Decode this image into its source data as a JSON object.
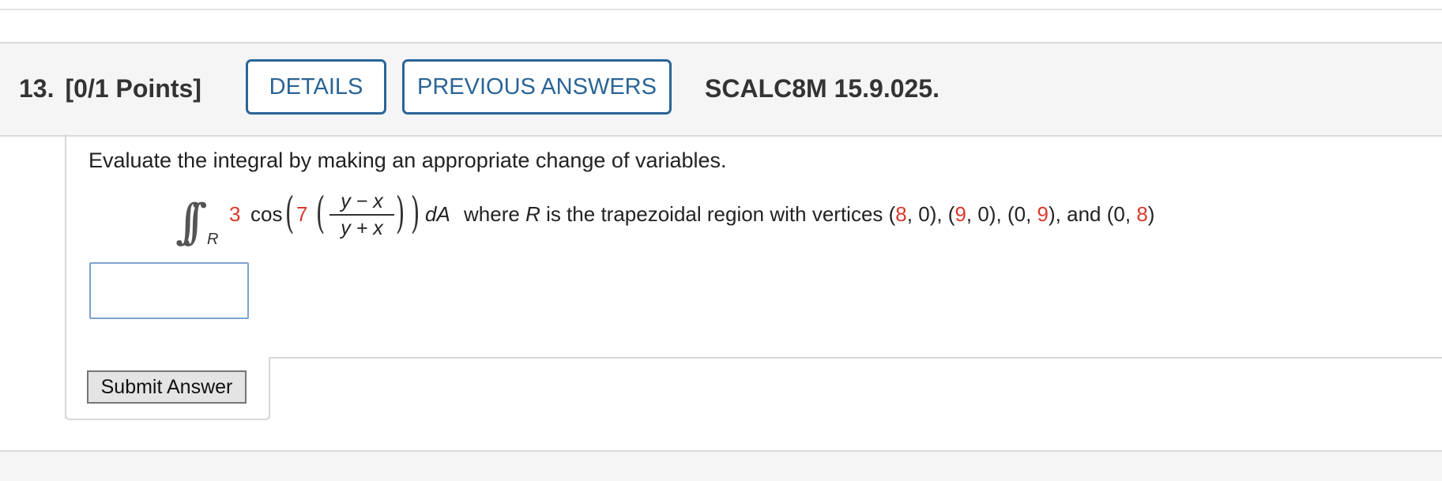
{
  "question": {
    "number": "13.",
    "points": "[0/1 Points]",
    "details_label": "DETAILS",
    "previous_answers_label": "PREVIOUS ANSWERS",
    "reference_code": "SCALC8M 15.9.025."
  },
  "problem": {
    "prompt": "Evaluate the integral by making an appropriate change of variables.",
    "integral_symbol": "∫∫",
    "region_subscript": "R",
    "coefficient": "3",
    "function": "cos",
    "inner_coefficient": "7",
    "numerator": "y − x",
    "denominator": "y + x",
    "differential": "dA",
    "where_text": "where",
    "region_var": "R",
    "description": "is the trapezoidal region with vertices",
    "vertices": [
      {
        "x": "8",
        "y": "0"
      },
      {
        "x": "9",
        "y": "0"
      },
      {
        "x": "0",
        "y": "9"
      },
      {
        "x": "0",
        "y": "8"
      }
    ],
    "and_text": "and"
  },
  "answer": {
    "value": ""
  },
  "submit_label": "Submit Answer",
  "colors": {
    "accent": "#2a6496",
    "highlight": "#d93a2b"
  }
}
